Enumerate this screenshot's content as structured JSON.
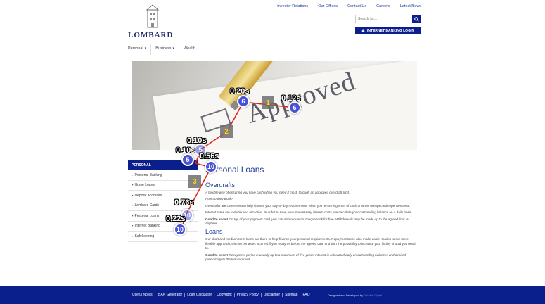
{
  "brand": {
    "name": "LOMBARD"
  },
  "top_links": [
    "Investor Relations",
    "Our Offices",
    "Contact Us",
    "Careers",
    "Latest News"
  ],
  "search": {
    "placeholder": "Search for..."
  },
  "internet_banking": {
    "label": "INTERNET BANKING LOGIN"
  },
  "main_nav": [
    {
      "label": "Personal",
      "has_dropdown": true
    },
    {
      "label": "Business",
      "has_dropdown": true
    },
    {
      "label": "Wealth",
      "has_dropdown": false
    }
  ],
  "hero": {
    "stamp_text": "Approved"
  },
  "sidebar": {
    "heading": "PERSONAL",
    "items": [
      "Personal Banking",
      "Home Loans",
      "Deposit Accounts",
      "Lombard Cards",
      "Personal Loans",
      "Internet Banking",
      "Safekeeping"
    ]
  },
  "content": {
    "title": "Personal Loans",
    "overdrafts_heading": "Overdrafts",
    "overdrafts_intro": "A flexible way of ensuring you have cash when you need it most, through an approved overdraft limit.",
    "how_heading": "How do they work?",
    "overdrafts_p1": "Overdrafts are convenient to help finance your day-to-day requirements when you're running short of cash or when unexpected expenses arise.",
    "overdrafts_p2": "Interest rates are variable and attractive. In order to save you unnecessary interest costs, we calculate your outstanding balance on a daily basis.",
    "good_to_know_label": "Good to know!",
    "overdrafts_tip": "On top of your payment card, you can also request a chequebook for free. Withdrawals may be made up to the agreed limit, at anytime.",
    "loans_heading": "Loans",
    "loans_p1": "Our short and medium-term loans are there to help finance your personal requirements. Repayments are also made easier thanks to our more flexible approach, with no penalties incurred if you repay us before the agreed date and with the possibility to increase your facility should you need to.",
    "loans_tip": "Repayment period is usually up to a maximum of five years; interest is calculated daily on outstanding balances and debited periodically to the loan account."
  },
  "footer": {
    "links": [
      "Useful Notes",
      "IBAN Generator",
      "Loan Calculator",
      "Copyright",
      "Privacy Policy",
      "Disclaimer",
      "Sitemap",
      "FAQ"
    ],
    "credit_text": "Designed and Developed by",
    "developer": "Deloitte Digital"
  },
  "overlay": {
    "marker_color": "#4a52d6",
    "path_color": "#e0241b",
    "step_text_color": "#ffd400",
    "markers": [
      "6",
      "6",
      "5",
      "5",
      "10",
      "10",
      "10"
    ],
    "time_labels": [
      "0.20s",
      "0.12s",
      "0.10s",
      "0.10s",
      "0.56s",
      "0.76s",
      "0.22s"
    ],
    "steps": [
      "1",
      "2",
      "3"
    ]
  }
}
